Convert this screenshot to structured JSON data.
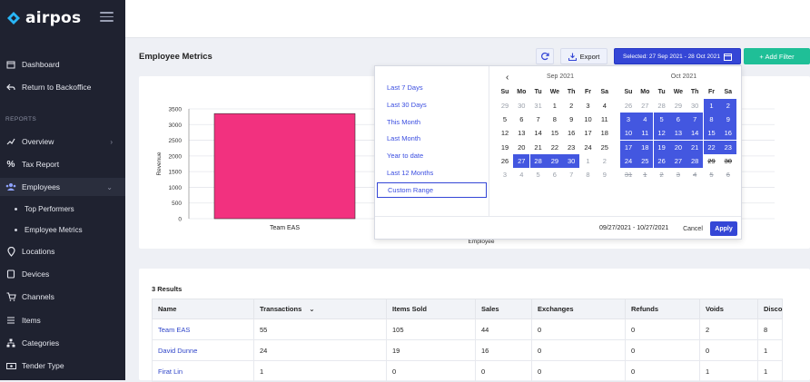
{
  "brand": {
    "name": "airpos"
  },
  "sidebar": {
    "items": [
      {
        "label": "Dashboard"
      },
      {
        "label": "Return to Backoffice"
      }
    ],
    "section_label": "REPORTS",
    "report_items": [
      {
        "label": "Overview"
      },
      {
        "label": "Tax Report"
      },
      {
        "label": "Employees"
      },
      {
        "label": "Locations"
      },
      {
        "label": "Devices"
      },
      {
        "label": "Channels"
      },
      {
        "label": "Items"
      },
      {
        "label": "Categories"
      },
      {
        "label": "Tender Type"
      }
    ],
    "sub_items": [
      {
        "label": "Top Performers"
      },
      {
        "label": "Employee Metrics"
      }
    ]
  },
  "header": {
    "title": "Employee Metrics",
    "export_label": "Export",
    "selected_label": "Selected: 27 Sep 2021 - 28 Oct 2021",
    "add_filter_label": "+ Add Filter"
  },
  "date_picker": {
    "ranges": [
      "Last 7 Days",
      "Last 30 Days",
      "This Month",
      "Last Month",
      "Year to date",
      "Last 12 Months",
      "Custom Range"
    ],
    "selected_range": "Custom Range",
    "weekdays": [
      "Su",
      "Mo",
      "Tu",
      "We",
      "Th",
      "Fr",
      "Sa"
    ],
    "left_month": "Sep 2021",
    "right_month": "Oct 2021",
    "left_days": [
      "29",
      "30",
      "31",
      "1",
      "2",
      "3",
      "4",
      "5",
      "6",
      "7",
      "8",
      "9",
      "10",
      "11",
      "12",
      "13",
      "14",
      "15",
      "16",
      "17",
      "18",
      "19",
      "20",
      "21",
      "22",
      "23",
      "24",
      "25",
      "26",
      "27",
      "28",
      "29",
      "30",
      "1",
      "2",
      "3",
      "4",
      "5",
      "6",
      "7",
      "8",
      "9"
    ],
    "right_days": [
      "26",
      "27",
      "28",
      "29",
      "30",
      "1",
      "2",
      "3",
      "4",
      "5",
      "6",
      "7",
      "8",
      "9",
      "10",
      "11",
      "12",
      "13",
      "14",
      "15",
      "16",
      "17",
      "18",
      "19",
      "20",
      "21",
      "22",
      "23",
      "24",
      "25",
      "26",
      "27",
      "28",
      "29",
      "30",
      "31",
      "1",
      "2",
      "3",
      "4",
      "5",
      "6"
    ],
    "range_text": "09/27/2021 - 10/27/2021",
    "cancel_label": "Cancel",
    "apply_label": "Apply"
  },
  "chart_data": {
    "type": "bar",
    "categories": [
      "Team EAS"
    ],
    "values": [
      3350
    ],
    "xlabel": "Employee",
    "ylabel": "Revenue",
    "ylim": [
      0,
      3500
    ],
    "yticks": [
      0,
      500,
      1000,
      1500,
      2000,
      2500,
      3000,
      3500
    ],
    "bar_color": "#f2317f",
    "grid": true
  },
  "table": {
    "results_label": "3 Results",
    "headers": [
      "Name",
      "Transactions",
      "Items Sold",
      "Sales",
      "Exchanges",
      "Refunds",
      "Voids",
      "Disco"
    ],
    "rows": [
      [
        "Team EAS",
        "55",
        "105",
        "44",
        "0",
        "0",
        "2",
        "8"
      ],
      [
        "David Dunne",
        "24",
        "19",
        "16",
        "0",
        "0",
        "0",
        "1"
      ],
      [
        "Firat Lin",
        "1",
        "0",
        "0",
        "0",
        "0",
        "1",
        "1"
      ]
    ]
  },
  "colors": {
    "sidebar": "#1f2230",
    "accent": "#3446d6",
    "add_filter": "#1fbf97"
  }
}
